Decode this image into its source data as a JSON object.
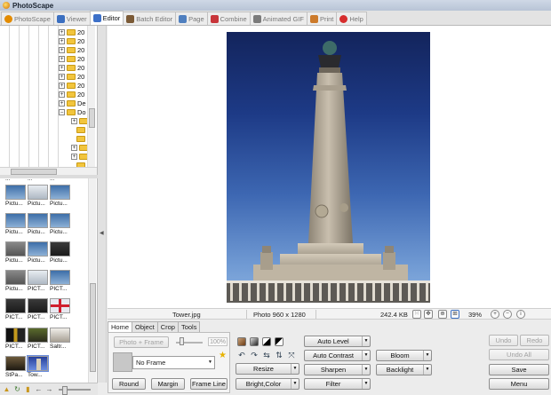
{
  "window": {
    "title": "PhotoScape"
  },
  "tabs": [
    {
      "label": "PhotoScape",
      "color": "#e38b00"
    },
    {
      "label": "Viewer",
      "color": "#3b6fc0"
    },
    {
      "label": "Editor",
      "color": "#3d70c8"
    },
    {
      "label": "Batch Editor",
      "color": "#7b5a36"
    },
    {
      "label": "Page",
      "color": "#4f7fbf"
    },
    {
      "label": "Combine",
      "color": "#c8353a"
    },
    {
      "label": "Animated GIF",
      "color": "#7b7b7b"
    },
    {
      "label": "Print",
      "color": "#cc7a2a"
    },
    {
      "label": "Help",
      "color": "#d62d2d"
    }
  ],
  "active_tab": "Editor",
  "folder_tree": {
    "items": [
      {
        "label": "20"
      },
      {
        "label": "20"
      },
      {
        "label": "20"
      },
      {
        "label": "20"
      },
      {
        "label": "20"
      },
      {
        "label": "20"
      },
      {
        "label": "20"
      },
      {
        "label": "20"
      },
      {
        "label": "De"
      },
      {
        "label": "Do"
      }
    ]
  },
  "thumbnails": {
    "cut_labels": [
      "...",
      "...",
      "..."
    ],
    "items": [
      {
        "label": "Pictu...",
        "tone": "sky"
      },
      {
        "label": "Pictu...",
        "tone": "white"
      },
      {
        "label": "Pictu...",
        "tone": "sky"
      },
      {
        "label": "Pictu...",
        "tone": "sky"
      },
      {
        "label": "Pictu...",
        "tone": "sky"
      },
      {
        "label": "Pictu...",
        "tone": "sky"
      },
      {
        "label": "Pictu...",
        "tone": "grey"
      },
      {
        "label": "Pictu...",
        "tone": "sky"
      },
      {
        "label": "Pictu...",
        "tone": "dark"
      },
      {
        "label": "Pictu...",
        "tone": "grey"
      },
      {
        "label": "PICT...",
        "tone": "white"
      },
      {
        "label": "PICT...",
        "tone": "sky"
      },
      {
        "label": "PICT...",
        "tone": "dark"
      },
      {
        "label": "PICT...",
        "tone": "dark"
      },
      {
        "label": "PICT...",
        "tone": "flag"
      },
      {
        "label": "PICT...",
        "tone": "dark"
      },
      {
        "label": "PICT...",
        "tone": "dark"
      },
      {
        "label": "Saltr...",
        "tone": "white"
      },
      {
        "label": "StPa...",
        "tone": "dark"
      },
      {
        "label": "Tow...",
        "tone": "blue"
      }
    ]
  },
  "image_info": {
    "filename": "Tower.jpg",
    "dimensions": "Photo 960 x 1280",
    "filesize": "242.4 KB",
    "zoom": "39%"
  },
  "edit_tabs": [
    "Home",
    "Object",
    "Crop",
    "Tools"
  ],
  "home": {
    "photo_frame": "Photo + Frame",
    "frame_percent": "100%",
    "frame_name": "No Frame",
    "round": "Round",
    "margin": "Margin",
    "frame_line": "Frame Line"
  },
  "adjust": {
    "resize": "Resize",
    "bright_color": "Bright,Color",
    "auto_level": "Auto Level",
    "auto_contrast": "Auto Contrast",
    "sharpen": "Sharpen",
    "filter": "Filter",
    "bloom": "Bloom",
    "backlight": "Backlight"
  },
  "actions": {
    "undo": "Undo",
    "redo": "Redo",
    "undo_all": "Undo All",
    "save": "Save",
    "menu": "Menu"
  }
}
